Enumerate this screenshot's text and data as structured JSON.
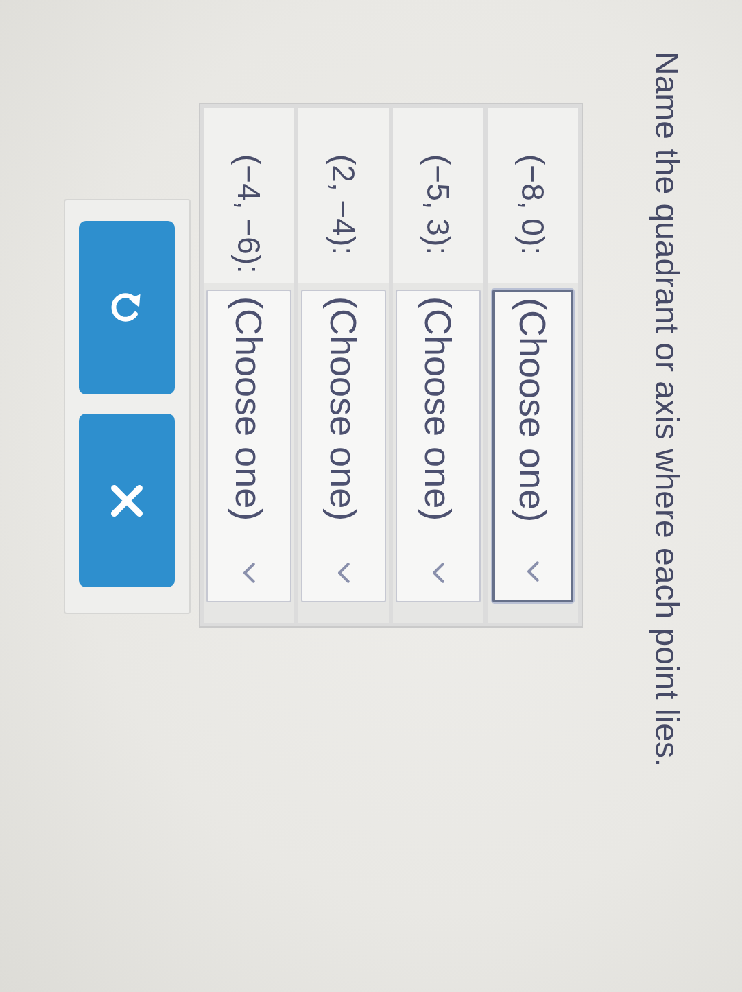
{
  "prompt": "Name the quadrant or axis where each point lies.",
  "rows": [
    {
      "point": "(−8, 0):",
      "dropdown": {
        "value": "(Choose one)",
        "focused": true
      }
    },
    {
      "point": "(−5, 3):",
      "dropdown": {
        "value": "(Choose one)",
        "focused": false
      }
    },
    {
      "point": "(2, −4):",
      "dropdown": {
        "value": "(Choose one)",
        "focused": false
      }
    },
    {
      "point": "(−4, −6):",
      "dropdown": {
        "value": "(Choose one)",
        "focused": false
      }
    }
  ],
  "buttons": [
    {
      "kind": "undo"
    },
    {
      "kind": "clear"
    }
  ]
}
